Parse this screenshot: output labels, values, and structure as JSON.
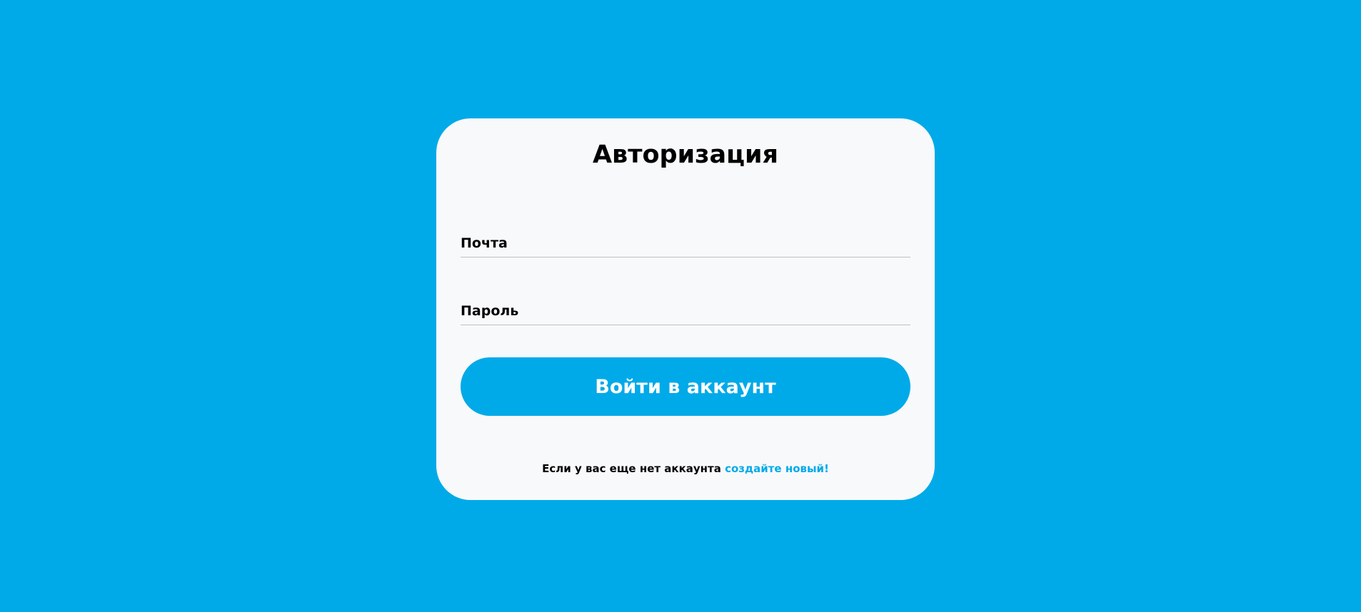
{
  "colors": {
    "background": "#00aae8",
    "card": "#f8f9fb",
    "accent": "#00aae8",
    "text": "#000000",
    "button_text": "#ffffff"
  },
  "auth": {
    "title": "Авторизация",
    "email_field": {
      "placeholder": "Почта",
      "value": ""
    },
    "password_field": {
      "placeholder": "Пароль",
      "value": ""
    },
    "submit_label": "Войти в аккаунт",
    "footer_text": "Если у вас еще нет аккаунта",
    "register_link": "создайте новый!"
  }
}
